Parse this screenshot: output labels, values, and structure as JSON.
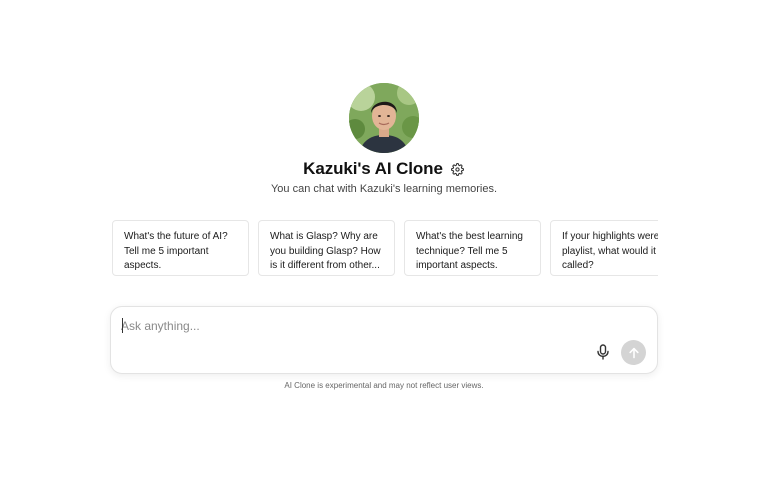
{
  "profile": {
    "title": "Kazuki's AI Clone",
    "subtitle": "You can chat with Kazuki's learning memories."
  },
  "suggestions": [
    {
      "text": "What's the future of AI? Tell me 5 important aspects."
    },
    {
      "text": "What is Glasp? Why are you building Glasp? How is it different from other..."
    },
    {
      "text": "What's the best learning technique? Tell me 5 important aspects."
    },
    {
      "text": "If your highlights were playlist, what would it called?"
    }
  ],
  "composer": {
    "placeholder": "Ask anything...",
    "value": ""
  },
  "footer": {
    "disclaimer": "AI Clone is experimental and may not reflect user views."
  },
  "icons": {
    "settings": "gear-icon",
    "microphone": "microphone-icon",
    "send": "arrow-up-icon"
  },
  "colors": {
    "background": "#ffffff",
    "send_button": "#d4d4d4",
    "card_border": "#e6e6e6"
  }
}
